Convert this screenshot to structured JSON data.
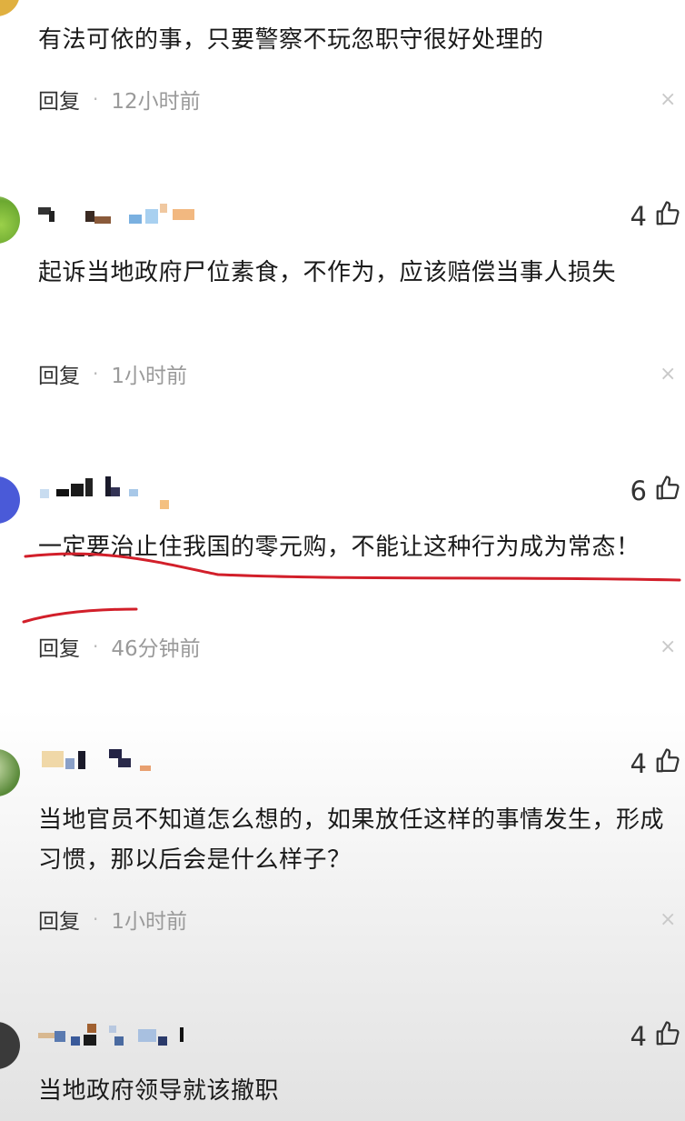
{
  "comments": [
    {
      "text": "有法可依的事，只要警察不玩忽职守很好处理的",
      "reply_label": "回复",
      "separator": "·",
      "time": "12小时前",
      "close_symbol": "×"
    },
    {
      "likes": "4",
      "text": "起诉当地政府尸位素食，不作为，应该赔偿当事人损失",
      "reply_label": "回复",
      "separator": "·",
      "time": "1小时前",
      "close_symbol": "×",
      "avatar_color": "#7fbf3f"
    },
    {
      "likes": "6",
      "text": "一定要治止住我国的零元购，不能让这种行为成为常态！",
      "reply_label": "回复",
      "separator": "·",
      "time": "46分钟前",
      "close_symbol": "×",
      "avatar_color": "#4a5ad8",
      "underline_color": "#d21f2a"
    },
    {
      "likes": "4",
      "text": "当地官员不知道怎么想的，如果放任这样的事情发生，形成习惯，那以后会是什么样子？",
      "reply_label": "回复",
      "separator": "·",
      "time": "1小时前",
      "close_symbol": "×",
      "avatar_color": "#5a8a3a"
    },
    {
      "likes": "4",
      "text": "当地政府领导就该撤职",
      "avatar_color": "#3a3a3a"
    }
  ],
  "icons": {
    "like": "thumbs-up-icon",
    "close": "close-icon"
  }
}
